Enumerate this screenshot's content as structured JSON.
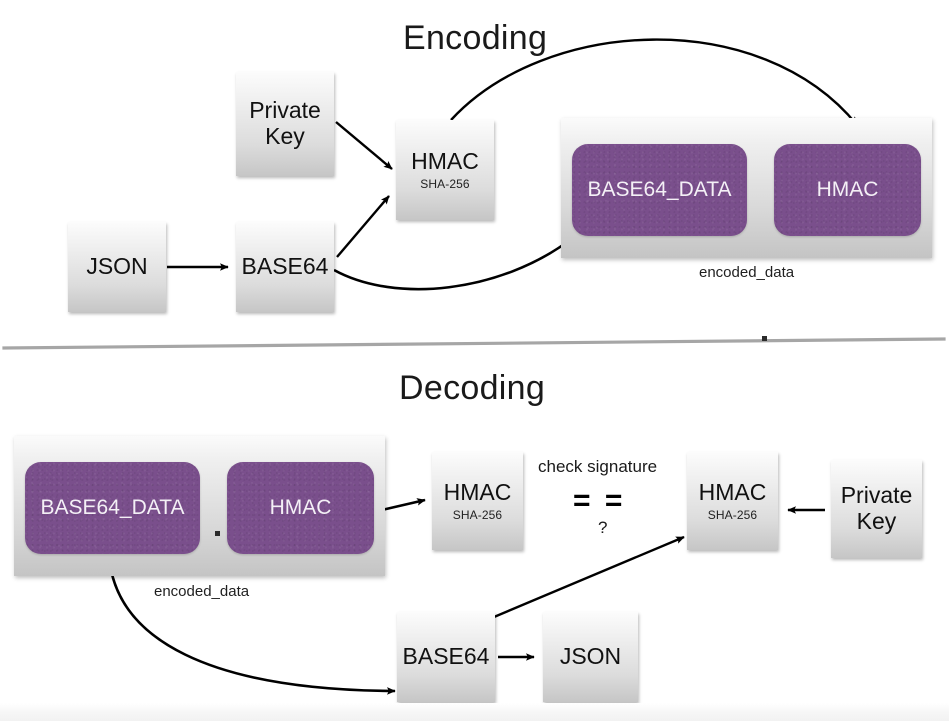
{
  "diagram": {
    "title_encoding": "Encoding",
    "title_decoding": "Decoding"
  },
  "encoding": {
    "nodes": {
      "private_key": {
        "label": "Private\nKey"
      },
      "hmac": {
        "label": "HMAC",
        "sub": "SHA-256"
      },
      "json": {
        "label": "JSON"
      },
      "base64": {
        "label": "BASE64"
      }
    },
    "encoded_data": {
      "caption": "encoded_data",
      "part_data": "BASE64_DATA",
      "separator": ".",
      "part_hmac": "HMAC"
    }
  },
  "decoding": {
    "encoded_data": {
      "caption": "encoded_data",
      "part_data": "BASE64_DATA",
      "separator": ".",
      "part_hmac": "HMAC"
    },
    "nodes": {
      "hmac_left": {
        "label": "HMAC",
        "sub": "SHA-256"
      },
      "hmac_right": {
        "label": "HMAC",
        "sub": "SHA-256"
      },
      "private_key": {
        "label": "Private\nKey"
      },
      "base64": {
        "label": "BASE64"
      },
      "json": {
        "label": "JSON"
      }
    },
    "compare": {
      "label": "check signature",
      "operator": "= =",
      "question": "?"
    }
  },
  "colors": {
    "purple": "#7a4f8c",
    "box_light": "#fcfcfc",
    "box_dark": "#c6c6c6",
    "stroke": "#000000",
    "divider": "#9a9a9a"
  }
}
